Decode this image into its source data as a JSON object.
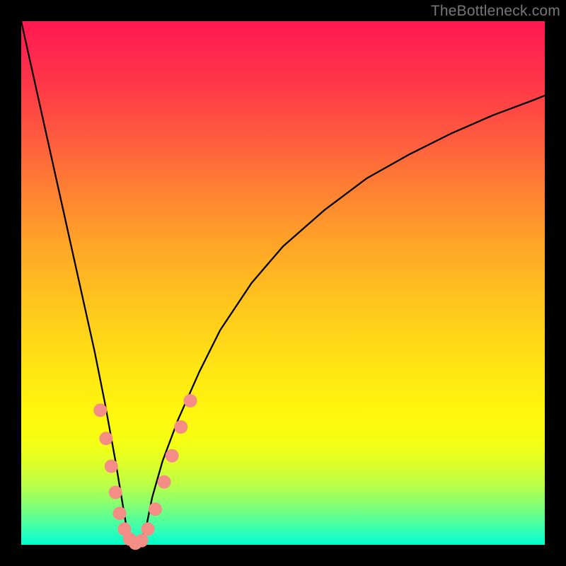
{
  "watermark": "TheBottleneck.com",
  "chart_data": {
    "type": "line",
    "title": "",
    "xlabel": "",
    "ylabel": "",
    "xlim": [
      0,
      100
    ],
    "ylim": [
      0,
      100
    ],
    "series": [
      {
        "name": "curve",
        "x": [
          0,
          2,
          4,
          6,
          8,
          10,
          12,
          14,
          16,
          18,
          19,
          20,
          21,
          22,
          23,
          24,
          25,
          27,
          30,
          34,
          38,
          44,
          50,
          58,
          66,
          74,
          82,
          90,
          98,
          100
        ],
        "y": [
          100,
          91,
          82,
          73,
          64,
          55,
          46,
          37,
          27,
          16,
          10,
          4,
          1,
          0,
          1,
          4,
          9,
          16,
          24,
          33,
          41,
          50,
          57,
          64,
          70,
          74.5,
          78.5,
          82,
          85,
          85.8
        ]
      }
    ],
    "markers": {
      "name": "highlight-dots",
      "color": "#f38d86",
      "points": [
        {
          "x": 15.1,
          "y": 25.7
        },
        {
          "x": 16.2,
          "y": 20.3
        },
        {
          "x": 17.2,
          "y": 15.0
        },
        {
          "x": 18.0,
          "y": 10.0
        },
        {
          "x": 18.8,
          "y": 6.0
        },
        {
          "x": 19.7,
          "y": 3.0
        },
        {
          "x": 20.7,
          "y": 1.1
        },
        {
          "x": 21.8,
          "y": 0.3
        },
        {
          "x": 23.0,
          "y": 0.8
        },
        {
          "x": 24.2,
          "y": 3.0
        },
        {
          "x": 25.6,
          "y": 6.8
        },
        {
          "x": 27.3,
          "y": 12.0
        },
        {
          "x": 28.8,
          "y": 17.0
        },
        {
          "x": 30.5,
          "y": 22.5
        },
        {
          "x": 32.3,
          "y": 27.5
        }
      ]
    }
  }
}
